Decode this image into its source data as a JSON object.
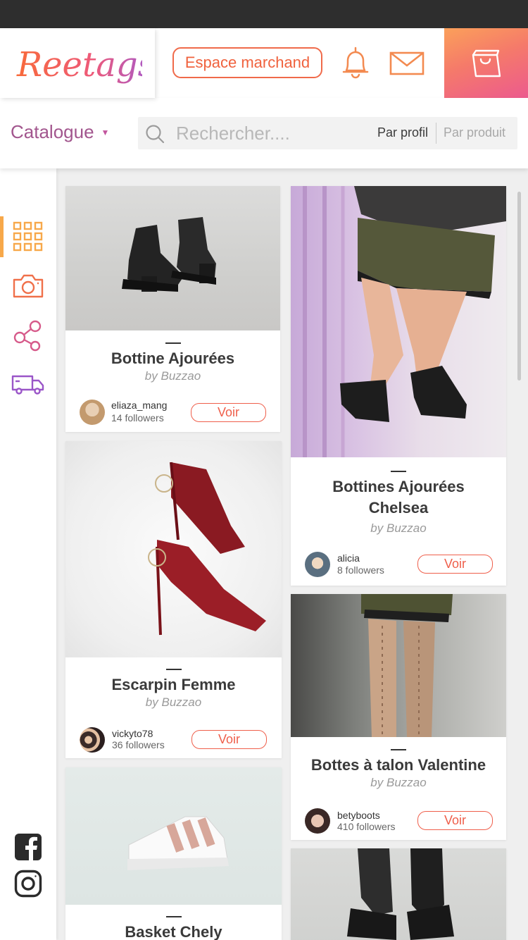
{
  "app": {
    "logo_text": "Reetags"
  },
  "header": {
    "merchant_label": "Espace marchand"
  },
  "nav": {
    "catalogue_label": "Catalogue",
    "search_placeholder": "Rechercher....",
    "filter_profile": "Par profil",
    "filter_product": "Par produit"
  },
  "sidebar": {
    "items": [
      {
        "icon": "grid-icon",
        "active": true
      },
      {
        "icon": "camera-icon",
        "active": false
      },
      {
        "icon": "share-icon",
        "active": false
      },
      {
        "icon": "truck-icon",
        "active": false
      }
    ],
    "social": [
      "facebook-icon",
      "instagram-icon"
    ]
  },
  "colors": {
    "accent": "#f0623e",
    "brand_purple": "#a2568e",
    "orange": "#f7a84a",
    "pink": "#ec5a8e"
  },
  "products": [
    {
      "title": "Bottine Ajourées",
      "brand": "by Buzzao",
      "user": "eliaza_mang",
      "followers": "14 followers",
      "action": "Voir"
    },
    {
      "title": "Bottines Ajourées Chelsea",
      "brand": "by Buzzao",
      "user": "alicia",
      "followers": "8 followers",
      "action": "Voir"
    },
    {
      "title": "Escarpin Femme",
      "brand": "by Buzzao",
      "user": "vickyto78",
      "followers": "36 followers",
      "action": "Voir"
    },
    {
      "title": "Bottes à talon Valentine",
      "brand": "by Buzzao",
      "user": "betyboots",
      "followers": "410 followers",
      "action": "Voir"
    },
    {
      "title": "Basket Chely",
      "brand": "",
      "user": "",
      "followers": "",
      "action": ""
    }
  ]
}
